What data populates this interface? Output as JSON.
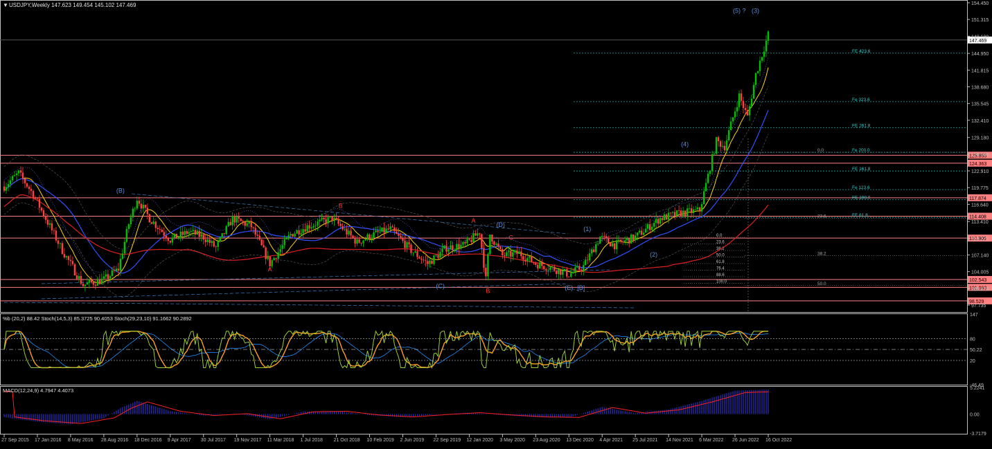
{
  "header": {
    "symbol_line": "USDJPY,Weekly  147.623 149.454 145.102 147.469"
  },
  "colors": {
    "background": "#000000",
    "axis": "#c0c0c0",
    "bull": "#00c000",
    "bear": "#ff4040",
    "level_line": "#ff7f7f",
    "price_tag": "#ff8080",
    "fib_line": "#3cc",
    "fib_text": "#3cc",
    "wave_text": "#5b8bd6",
    "wave_red": "#ff3030",
    "ma_fast": "#ffd700",
    "ma_mid": "#3050ff",
    "ma_slow": "#e02020",
    "stoch_fast": "#9acd32",
    "stoch_slow": "#ffa020",
    "bb_line": "#1e90ff",
    "macd_hist": "#3030c0",
    "macd_signal": "#ff2020"
  },
  "chart_data": [
    {
      "type": "candlestick",
      "title": "USDJPY,Weekly",
      "ohlc_last": {
        "open": 147.623,
        "high": 149.454,
        "low": 145.102,
        "close": 147.469
      },
      "ylim": [
        97.735,
        154.45
      ],
      "y_ticks": [
        "154.450",
        "151.315",
        "148.180",
        "144.950",
        "141.815",
        "138.680",
        "135.545",
        "132.410",
        "129.180",
        "126.045",
        "122.910",
        "119.775",
        "116.640",
        "113.410",
        "110.275",
        "107.140",
        "104.005",
        "100.870",
        "97.735"
      ],
      "x_ticks": [
        "27 Sep 2015",
        "17 Jan 2016",
        "8 May 2016",
        "28 Aug 2016",
        "18 Dec 2016",
        "9 Apr 2017",
        "30 Jul 2017",
        "19 Nov 2017",
        "11 Mar 2018",
        "1 Jul 2018",
        "21 Oct 2018",
        "10 Feb 2019",
        "2 Jun 2019",
        "22 Sep 2019",
        "12 Jan 2020",
        "3 May 2020",
        "23 Aug 2020",
        "13 Dec 2020",
        "4 Apr 2021",
        "25 Jul 2021",
        "14 Nov 2021",
        "6 Mar 2022",
        "26 Jun 2022",
        "16 Oct 2022"
      ],
      "weekly_close_path": [
        [
          "2015-09-27",
          120.0
        ],
        [
          "2015-11-15",
          122.5
        ],
        [
          "2016-01-03",
          118.5
        ],
        [
          "2016-02-14",
          114.0
        ],
        [
          "2016-04-10",
          108.0
        ],
        [
          "2016-06-19",
          101.5
        ],
        [
          "2016-08-28",
          102.5
        ],
        [
          "2016-10-16",
          104.5
        ],
        [
          "2016-11-20",
          113.0
        ],
        [
          "2016-12-18",
          117.8
        ],
        [
          "2017-01-29",
          114.0
        ],
        [
          "2017-04-09",
          110.0
        ],
        [
          "2017-06-11",
          111.5
        ],
        [
          "2017-07-30",
          110.5
        ],
        [
          "2017-09-10",
          108.5
        ],
        [
          "2017-11-05",
          114.0
        ],
        [
          "2018-01-07",
          112.5
        ],
        [
          "2018-03-11",
          105.5
        ],
        [
          "2018-05-20",
          111.0
        ],
        [
          "2018-07-15",
          112.5
        ],
        [
          "2018-10-07",
          114.0
        ],
        [
          "2018-12-30",
          109.5
        ],
        [
          "2019-02-24",
          111.0
        ],
        [
          "2019-04-21",
          112.0
        ],
        [
          "2019-06-30",
          108.0
        ],
        [
          "2019-08-25",
          105.5
        ],
        [
          "2019-10-27",
          108.5
        ],
        [
          "2019-12-29",
          109.0
        ],
        [
          "2020-02-16",
          111.5
        ],
        [
          "2020-03-08",
          102.5
        ],
        [
          "2020-03-22",
          111.0
        ],
        [
          "2020-05-03",
          107.0
        ],
        [
          "2020-06-28",
          107.5
        ],
        [
          "2020-08-23",
          105.5
        ],
        [
          "2020-10-25",
          104.5
        ],
        [
          "2020-12-13",
          103.5
        ],
        [
          "2021-01-31",
          105.0
        ],
        [
          "2021-03-28",
          110.5
        ],
        [
          "2021-05-16",
          109.0
        ],
        [
          "2021-07-25",
          110.5
        ],
        [
          "2021-10-17",
          114.0
        ],
        [
          "2021-12-26",
          115.0
        ],
        [
          "2022-02-27",
          115.5
        ],
        [
          "2022-03-27",
          122.0
        ],
        [
          "2022-04-24",
          128.5
        ],
        [
          "2022-05-22",
          127.5
        ],
        [
          "2022-07-10",
          137.0
        ],
        [
          "2022-08-07",
          133.0
        ],
        [
          "2022-09-04",
          141.0
        ],
        [
          "2022-10-16",
          148.5
        ],
        [
          "2022-10-23",
          147.469
        ]
      ],
      "price_levels": [
        125.855,
        124.363,
        117.874,
        114.408,
        110.305,
        102.543,
        101.063,
        98.529
      ],
      "current_price": 147.469,
      "fib_extensions": [
        {
          "label": "FE 423.6",
          "value": 145.0
        },
        {
          "label": "Fe 323.6",
          "value": 135.9
        },
        {
          "label": "FE 261.8",
          "value": 131.0
        },
        {
          "label": "Fe 200.0",
          "value": 126.4
        },
        {
          "label": "FE 161.8",
          "value": 122.9
        },
        {
          "label": "Fe 123.6",
          "value": 119.4
        },
        {
          "label": "FE 100.0",
          "value": 117.5
        },
        {
          "label": "FE 61.8",
          "value": 114.2
        }
      ],
      "fib_retracement_labels": [
        {
          "label": "0.0",
          "value": 126.4
        },
        {
          "label": "23.6",
          "value": 114.0
        },
        {
          "label": "38.2",
          "value": 107.0
        },
        {
          "label": "50.0",
          "value": 101.4
        }
      ],
      "fib_small_ladder": [
        "0.0",
        "23.6",
        "38.2",
        "50.0",
        "61.8",
        "76.4",
        "88.6",
        "100.0"
      ],
      "wave_labels": [
        {
          "text": "(5) ?",
          "date": "2022-06-19",
          "value": 152.6,
          "color": "blue"
        },
        {
          "text": "(3)",
          "date": "2022-08-21",
          "value": 152.6,
          "color": "blue"
        },
        {
          "text": "(4)",
          "date": "2021-12-26",
          "value": 127.5,
          "color": "blue"
        },
        {
          "text": "(B)",
          "date": "2016-10-09",
          "value": 118.8,
          "color": "blue"
        },
        {
          "text": "(1)",
          "date": "2021-01-31",
          "value": 111.6,
          "color": "blue"
        },
        {
          "text": "(2)",
          "date": "2021-09-12",
          "value": 106.8,
          "color": "blue"
        },
        {
          "text": "(D)",
          "date": "2020-04-12",
          "value": 112.4,
          "color": "blue"
        },
        {
          "text": "(C)",
          "date": "2019-09-22",
          "value": 100.9,
          "color": "blue"
        },
        {
          "text": "(E)",
          "date": "2020-11-29",
          "value": 100.6,
          "color": "blue"
        },
        {
          "text": "[B]",
          "date": "2021-01-10",
          "value": 100.6,
          "color": "blue"
        },
        {
          "text": "B",
          "date": "2018-10-28",
          "value": 116.0,
          "color": "red"
        },
        {
          "text": "A",
          "date": "2020-01-19",
          "value": 113.2,
          "color": "red"
        },
        {
          "text": "A",
          "date": "2018-03-04",
          "value": 104.0,
          "color": "red"
        },
        {
          "text": "B",
          "date": "2020-03-08",
          "value": 100.0,
          "color": "red"
        },
        {
          "text": "C",
          "date": "2020-05-24",
          "value": 110.0,
          "color": "red"
        }
      ]
    },
    {
      "type": "line",
      "title": "%b (20,2) 88.42  Stoch(14,5,3) 85.3725 90.4053  Stoch(29,23,10) 91.1662 90.2892",
      "ylim": [
        -46.49,
        147
      ],
      "y_ticks": [
        "147",
        "80",
        "50.22",
        "20",
        "-46.49"
      ],
      "series": [
        {
          "name": "%b (20,2)",
          "last": 88.42
        },
        {
          "name": "Stoch(14,5,3)",
          "last": [
            85.3725,
            90.4053
          ]
        },
        {
          "name": "Stoch(29,23,10)",
          "last": [
            91.1662,
            90.2892
          ]
        }
      ],
      "levels": [
        80,
        50.22,
        20
      ]
    },
    {
      "type": "bar",
      "title": "MACD(12,24,9) 4.7947 4.4073",
      "ylim": [
        -3.7179,
        5.2241
      ],
      "y_ticks": [
        "5.2241",
        "0.00",
        "-3.7179"
      ],
      "series": [
        {
          "name": "MACD(12,24,9)",
          "last": 4.7947
        },
        {
          "name": "Signal",
          "last": 4.4073
        }
      ],
      "path": [
        [
          "2015-09-27",
          -0.6
        ],
        [
          "2016-01-03",
          -1.4
        ],
        [
          "2016-05-08",
          -2.0
        ],
        [
          "2016-08-28",
          -0.8
        ],
        [
          "2016-10-23",
          1.2
        ],
        [
          "2016-12-18",
          2.6
        ],
        [
          "2017-04-09",
          0.6
        ],
        [
          "2017-07-30",
          -0.3
        ],
        [
          "2017-11-19",
          0.1
        ],
        [
          "2018-03-11",
          -1.0
        ],
        [
          "2018-07-01",
          0.5
        ],
        [
          "2018-10-21",
          0.6
        ],
        [
          "2019-02-10",
          -0.2
        ],
        [
          "2019-06-02",
          -0.6
        ],
        [
          "2019-09-22",
          -0.1
        ],
        [
          "2020-01-12",
          0.3
        ],
        [
          "2020-05-03",
          -0.2
        ],
        [
          "2020-08-23",
          -0.6
        ],
        [
          "2020-12-13",
          -0.7
        ],
        [
          "2021-04-04",
          1.4
        ],
        [
          "2021-07-25",
          0.2
        ],
        [
          "2021-11-14",
          0.9
        ],
        [
          "2022-03-06",
          2.6
        ],
        [
          "2022-06-26",
          4.6
        ],
        [
          "2022-10-16",
          4.8
        ]
      ]
    }
  ]
}
